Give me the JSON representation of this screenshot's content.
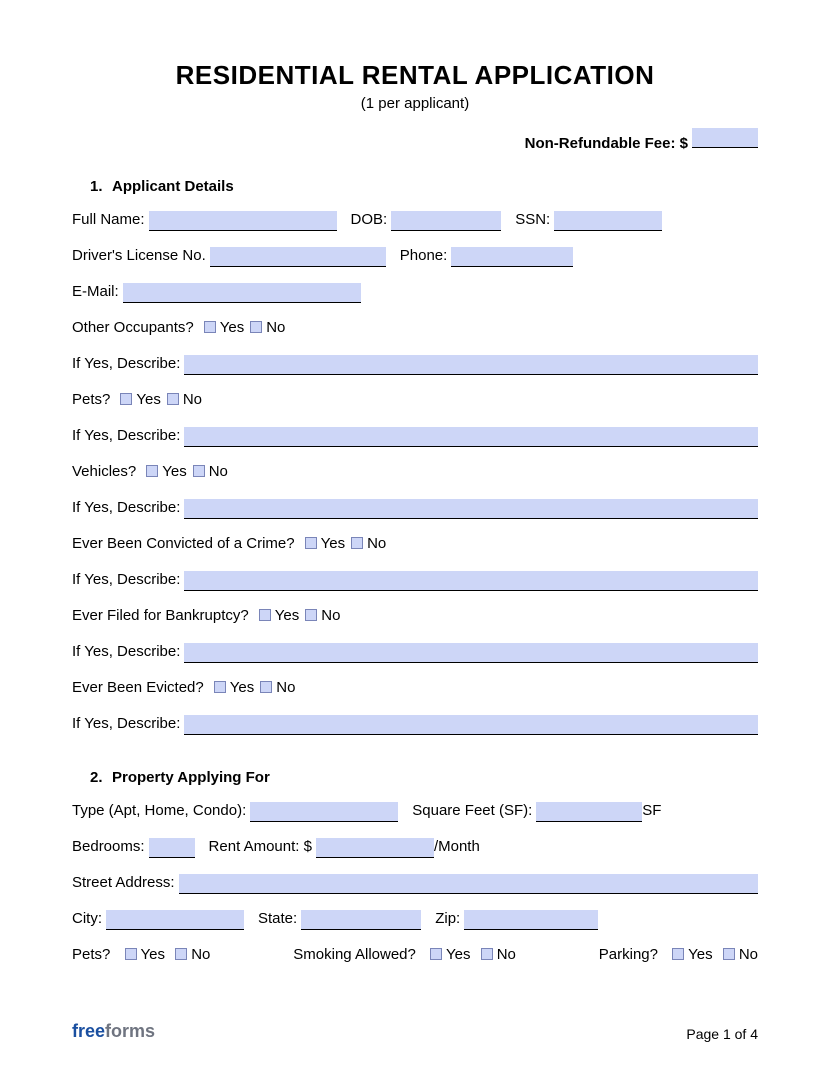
{
  "title": "RESIDENTIAL RENTAL APPLICATION",
  "subtitle": "(1 per applicant)",
  "fee_label": "Non-Refundable Fee: $",
  "dollar": "$",
  "yes": "Yes",
  "no": "No",
  "section1": {
    "num": "1.",
    "title": "Applicant Details",
    "full_name": "Full Name:",
    "dob": "DOB:",
    "ssn": "SSN:",
    "dl": "Driver's License No.",
    "phone": "Phone:",
    "email": "E-Mail:",
    "other_occ": "Other Occupants?",
    "if_yes": "If Yes, Describe:",
    "pets": "Pets?",
    "vehicles": "Vehicles?",
    "crime": "Ever Been Convicted of a Crime?",
    "bankruptcy": "Ever Filed for Bankruptcy?",
    "evicted": "Ever Been Evicted?"
  },
  "section2": {
    "num": "2.",
    "title": "Property Applying For",
    "type": "Type (Apt, Home, Condo):",
    "sf": "Square Feet (SF):",
    "sf_suffix": "SF",
    "bedrooms": "Bedrooms:",
    "rent": "Rent Amount: $",
    "per_month": "/Month",
    "street": "Street Address:",
    "city": "City:",
    "state": "State:",
    "zip": "Zip:",
    "pets": "Pets?",
    "smoking": "Smoking Allowed?",
    "parking": "Parking?"
  },
  "footer": {
    "logo1": "free",
    "logo2": "forms",
    "page": "Page 1 of 4"
  }
}
